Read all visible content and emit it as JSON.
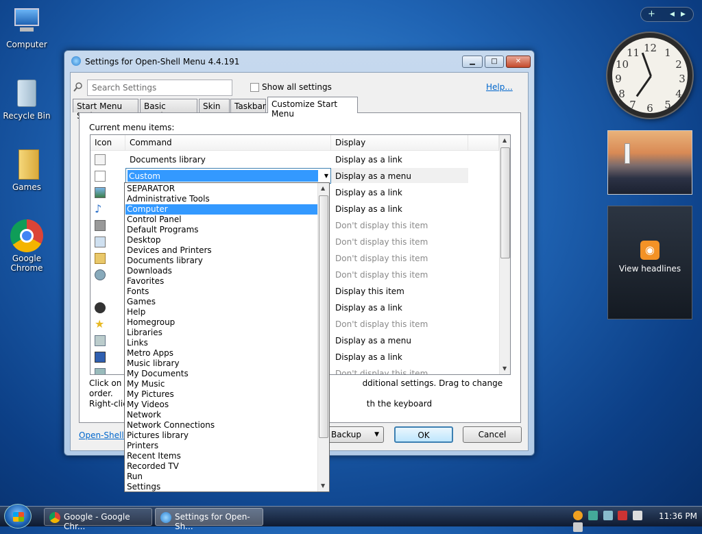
{
  "desktop": {
    "icons": [
      {
        "label": "Computer"
      },
      {
        "label": "Recycle Bin"
      },
      {
        "label": "Games"
      },
      {
        "label": "Google Chrome"
      }
    ],
    "gadgets": {
      "headlines_label": "View headlines",
      "bar_plus": "+",
      "clock_numbers": [
        "12",
        "1",
        "2",
        "3",
        "4",
        "5",
        "6",
        "7",
        "8",
        "9",
        "10",
        "11"
      ]
    }
  },
  "window": {
    "title": "Settings for Open-Shell Menu 4.4.191",
    "search_placeholder": "Search Settings",
    "show_all_label": "Show all settings",
    "help_label": "Help...",
    "tabs": [
      {
        "label": "Start Menu Style"
      },
      {
        "label": "Basic Settings"
      },
      {
        "label": "Skin"
      },
      {
        "label": "Taskbar"
      },
      {
        "label": "Customize Start Menu"
      }
    ],
    "current_items_label": "Current menu items:",
    "columns": {
      "icon": "Icon",
      "command": "Command",
      "display": "Display"
    },
    "rows": [
      {
        "command": "Documents library",
        "display": "Display as a link"
      },
      {
        "command": "Custom",
        "display": "Display as a menu"
      },
      {
        "command": "",
        "display": "Display as a link"
      },
      {
        "command": "",
        "display": "Display as a link"
      },
      {
        "command": "",
        "display": "Don't display this item"
      },
      {
        "command": "",
        "display": "Don't display this item"
      },
      {
        "command": "",
        "display": "Don't display this item"
      },
      {
        "command": "",
        "display": "Don't display this item"
      },
      {
        "command": "",
        "display": "Display this item"
      },
      {
        "command": "",
        "display": "Display as a link"
      },
      {
        "command": "",
        "display": "Don't display this item"
      },
      {
        "command": "",
        "display": "Display as a menu"
      },
      {
        "command": "",
        "display": "Display as a link"
      },
      {
        "command": "",
        "display": "Don't display this item"
      }
    ],
    "hint_line1_start": "Click on e",
    "hint_line1_end": "dditional settings. Drag to change order.",
    "hint_line2_start": "Right-clic",
    "hint_line2_end": "th the keyboard",
    "footer_link": "Open-Shell H",
    "backup_label": "Backup",
    "ok_label": "OK",
    "cancel_label": "Cancel",
    "combo_value": "Custom",
    "dropdown_items": [
      "SEPARATOR",
      "Administrative Tools",
      "Computer",
      "Control Panel",
      "Default Programs",
      "Desktop",
      "Devices and Printers",
      "Documents library",
      "Downloads",
      "Favorites",
      "Fonts",
      "Games",
      "Help",
      "Homegroup",
      "Libraries",
      "Links",
      "Metro Apps",
      "Music library",
      "My Documents",
      "My Music",
      "My Pictures",
      "My Videos",
      "Network",
      "Network Connections",
      "Pictures library",
      "Printers",
      "Recent Items",
      "Recorded TV",
      "Run",
      "Settings"
    ],
    "dropdown_selected_index": 2
  },
  "taskbar": {
    "tasks": [
      {
        "label": "Google - Google Chr..."
      },
      {
        "label": "Settings for Open-Sh..."
      }
    ],
    "time": "11:36 PM"
  }
}
